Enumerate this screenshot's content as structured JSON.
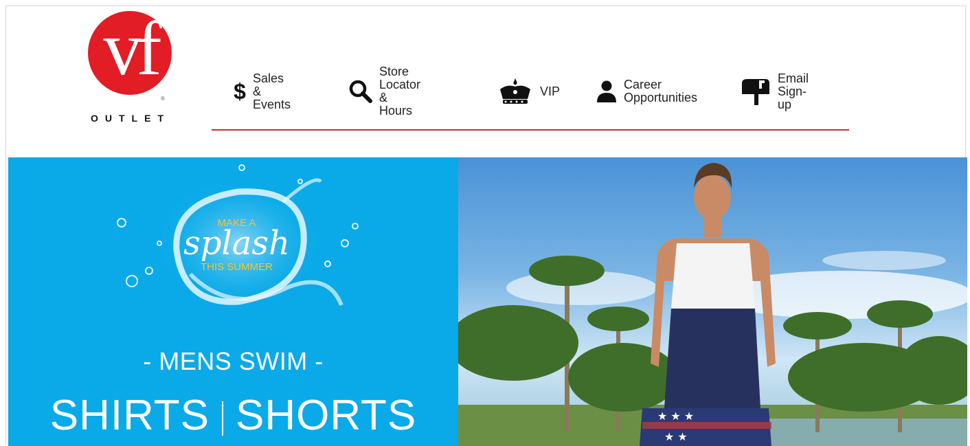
{
  "brand": {
    "logo_text": "vf",
    "registered": "®",
    "outlet": "OUTLET"
  },
  "nav": {
    "items": [
      {
        "line1": "Sales",
        "line2": "& Events",
        "icon": "dollar-icon",
        "glyph": "$"
      },
      {
        "line1": "Store Locator",
        "line2": "& Hours",
        "icon": "search-icon"
      },
      {
        "line1": "VIP",
        "line2": "",
        "icon": "crown-icon"
      },
      {
        "line1": "Career",
        "line2": "Opportunities",
        "icon": "person-icon"
      },
      {
        "line1": "Email",
        "line2": "Sign-up",
        "icon": "mailbox-icon"
      }
    ]
  },
  "hero": {
    "splash": {
      "make_a": "MAKE A",
      "word": "splash",
      "this_summer": "THIS SUMMER"
    },
    "category": "- MENS SWIM -",
    "products": [
      "SHIRTS",
      "SHORTS"
    ]
  },
  "colors": {
    "accent_red": "#e21d25",
    "hero_blue": "#0aaae8",
    "splash_yellow": "#f4c431",
    "rule_red": "#d22b2b"
  }
}
